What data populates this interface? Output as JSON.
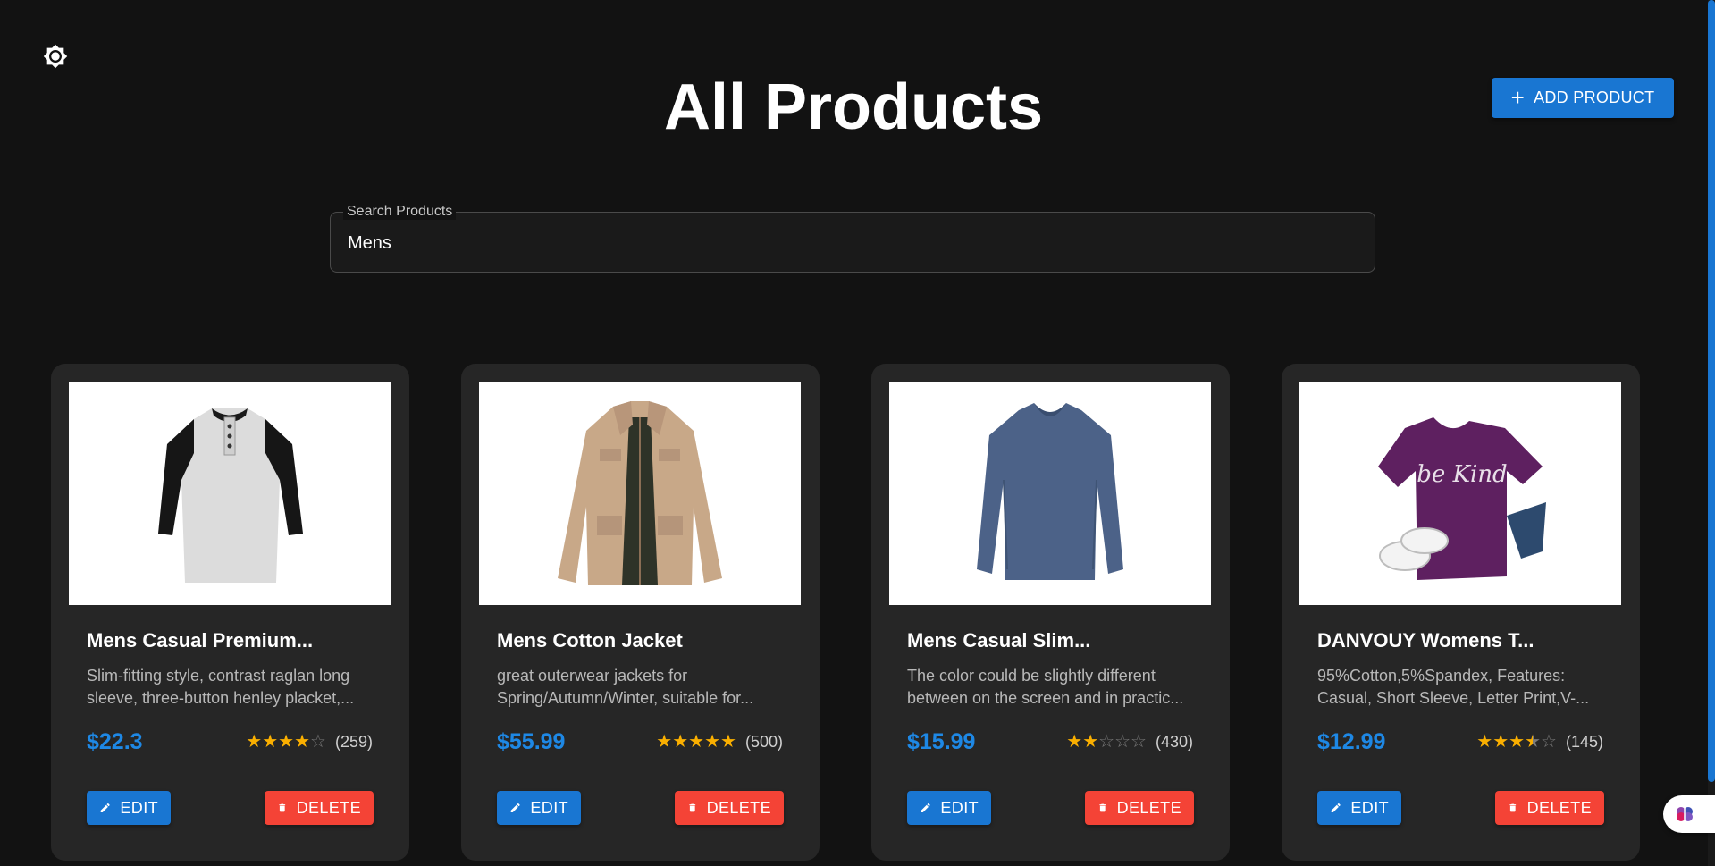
{
  "header": {
    "title": "All Products",
    "add_button_label": "ADD PRODUCT",
    "theme_toggle_icon": "brightness-icon"
  },
  "search": {
    "label": "Search Products",
    "value": "Mens"
  },
  "products": [
    {
      "title": "Mens Casual Premium...",
      "description": "Slim-fitting style, contrast raglan long sleeve, three-button henley placket,...",
      "price": "$22.3",
      "rating": 4,
      "rating_count": "(259)",
      "edit_label": "EDIT",
      "delete_label": "DELETE",
      "image_icon": "henley-shirt-image"
    },
    {
      "title": "Mens Cotton Jacket",
      "description": "great outerwear jackets for Spring/Autumn/Winter, suitable for...",
      "price": "$55.99",
      "rating": 5,
      "rating_count": "(500)",
      "edit_label": "EDIT",
      "delete_label": "DELETE",
      "image_icon": "cotton-jacket-image"
    },
    {
      "title": "Mens Casual Slim...",
      "description": "The color could be slightly different between on the screen and in practic...",
      "price": "$15.99",
      "rating": 2,
      "rating_count": "(430)",
      "edit_label": "EDIT",
      "delete_label": "DELETE",
      "image_icon": "slim-tee-image"
    },
    {
      "title": "DANVOUY Womens T...",
      "description": "95%Cotton,5%Spandex, Features: Casual, Short Sleeve, Letter Print,V-...",
      "price": "$12.99",
      "rating": 3.5,
      "rating_count": "(145)",
      "edit_label": "EDIT",
      "delete_label": "DELETE",
      "image_icon": "womens-tshirt-image",
      "image_text": "be Kind"
    }
  ],
  "colors": {
    "background": "#121212",
    "card": "#262626",
    "primary": "#1976d2",
    "danger": "#f44336",
    "price": "#1e88e5",
    "star": "#faaf00"
  }
}
